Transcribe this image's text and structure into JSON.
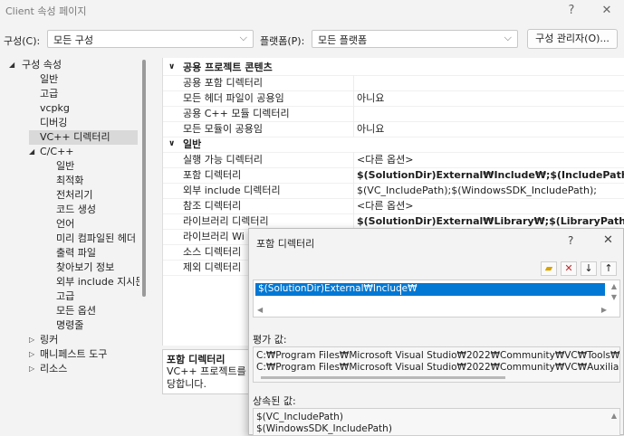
{
  "window": {
    "title": "Client 속성 페이지",
    "help": "?",
    "close": "✕"
  },
  "toolbar": {
    "config_label": "구성(C):",
    "config_value": "모든 구성",
    "platform_label": "플랫폼(P):",
    "platform_value": "모든 플랫폼",
    "config_manager": "구성 관리자(O)..."
  },
  "tree": {
    "root": "구성 속성",
    "items": [
      "일반",
      "고급",
      "vcpkg",
      "디버깅",
      "VC++ 디렉터리"
    ],
    "cpp": "C/C++",
    "cpp_items": [
      "일반",
      "최적화",
      "전처리기",
      "코드 생성",
      "언어",
      "미리 컴파일된 헤더",
      "출력 파일",
      "찾아보기 정보",
      "외부 include 지시문",
      "고급",
      "모든 옵션",
      "명령줄"
    ],
    "linker": "링커",
    "manifest": "매니페스트 도구",
    "resources": "리소스"
  },
  "grid": {
    "cat1": "공용 프로젝트 콘텐츠",
    "cat1_rows": [
      {
        "name": "공용 포함 디렉터리",
        "value": ""
      },
      {
        "name": "모든 헤더 파일이 공용임",
        "value": "아니요"
      },
      {
        "name": "공용 C++ 모듈 디렉터리",
        "value": ""
      },
      {
        "name": "모든 모듈이 공용임",
        "value": "아니요"
      }
    ],
    "cat2": "일반",
    "cat2_rows": [
      {
        "name": "실행 가능 디렉터리",
        "value": "<다른 옵션>"
      },
      {
        "name": "포함 디렉터리",
        "value": "$(SolutionDir)External₩Include₩;$(IncludePath)"
      },
      {
        "name": "외부 include 디렉터리",
        "value": "$(VC_IncludePath);$(WindowsSDK_IncludePath);"
      },
      {
        "name": "참조 디렉터리",
        "value": "<다른 옵션>"
      },
      {
        "name": "라이브러리 디렉터리",
        "value": "$(SolutionDir)External₩Library₩;$(LibraryPath)"
      },
      {
        "name": "라이브러리 Wi",
        "value": ""
      },
      {
        "name": "소스 디렉터리",
        "value": ""
      },
      {
        "name": "제외 디렉터리",
        "value": ""
      }
    ]
  },
  "description": {
    "title": "포함 디렉터리",
    "text": "VC++ 프로젝트를 당합니다."
  },
  "dialog": {
    "title": "포함 디렉터리",
    "help": "?",
    "close": "✕",
    "entry": "$(SolutionDir)External₩Include₩",
    "eval_label": "평가 값:",
    "eval_lines": [
      "C:₩Program Files₩Microsoft Visual Studio₩2022₩Community₩VC₩Tools₩MSV",
      "C:₩Program Files₩Microsoft Visual Studio₩2022₩Community₩VC₩Auxiliary₩V"
    ],
    "inherited_label": "상속된 값:",
    "inherited_lines": [
      "$(VC_IncludePath)",
      "$(WindowsSDK_IncludePath)"
    ]
  }
}
